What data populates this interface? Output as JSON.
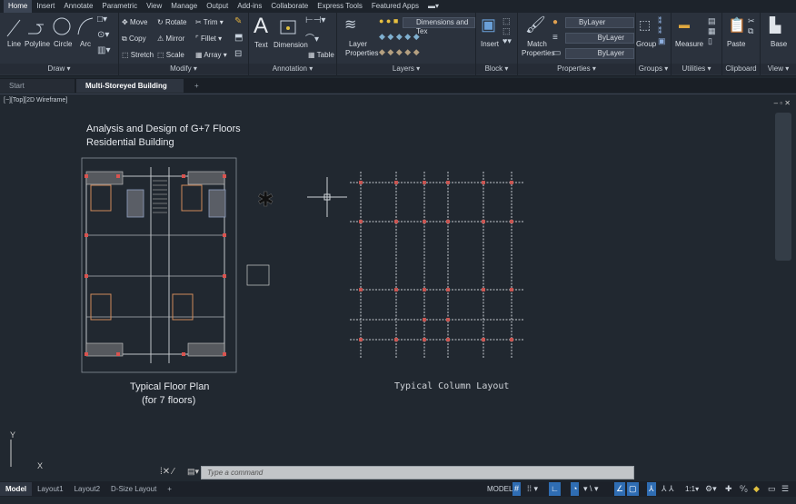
{
  "menu_tabs": [
    "Home",
    "Insert",
    "Annotate",
    "Parametric",
    "View",
    "Manage",
    "Output",
    "Add-ins",
    "Collaborate",
    "Express Tools",
    "Featured Apps"
  ],
  "ribbon": {
    "draw": {
      "title": "Draw ▾",
      "line": "Line",
      "polyline": "Polyline",
      "circle": "Circle",
      "arc": "Arc"
    },
    "modify": {
      "title": "Modify ▾",
      "move": "Move",
      "rotate": "Rotate",
      "trim": "Trim",
      "copy": "Copy",
      "mirror": "Mirror",
      "fillet": "Fillet",
      "stretch": "Stretch",
      "scale": "Scale",
      "array": "Array"
    },
    "annotation": {
      "title": "Annotation ▾",
      "text": "Text",
      "dimension": "Dimension",
      "table": "Table"
    },
    "layers": {
      "title": "Layers ▾",
      "layer_properties": "Layer Properties",
      "current_layer": "Dimensions and Tex"
    },
    "block": {
      "title": "Block ▾",
      "insert": "Insert"
    },
    "properties": {
      "title": "Properties ▾",
      "match": "Match Properties",
      "color": "ByLayer",
      "linetype": "ByLayer",
      "lineweight": "ByLayer"
    },
    "groups": {
      "title": "Groups ▾",
      "group": "Group"
    },
    "utilities": {
      "title": "Utilities ▾",
      "measure": "Measure"
    },
    "clipboard": {
      "title": "Clipboard",
      "paste": "Paste"
    },
    "view": {
      "title": "View ▾",
      "base": "Base"
    }
  },
  "doc_tabs": {
    "start": "Start",
    "active": "Multi-Storeyed Building Plan*",
    "close": "✕",
    "add": "+"
  },
  "viewport_label": "[−][Top][2D Wireframe]",
  "drawing": {
    "title_line1": "Analysis and Design of G+7 Floors",
    "title_line2": "Residential Building",
    "floor_plan_label1": "Typical Floor Plan",
    "floor_plan_label2": "(for 7 floors)",
    "column_layout_label": "Typical Column Layout"
  },
  "ucs": {
    "x": "X",
    "y": "Y"
  },
  "command": {
    "placeholder": "Type a command"
  },
  "layout_tabs": [
    "Model",
    "Layout1",
    "Layout2",
    "D-Size Layout"
  ],
  "status": {
    "model": "MODEL",
    "scale": "1:1"
  },
  "colors": {
    "accent": "#2f6db3",
    "column_marker": "#d9534f",
    "grid_line": "#c8ccd2",
    "background": "#212830"
  }
}
